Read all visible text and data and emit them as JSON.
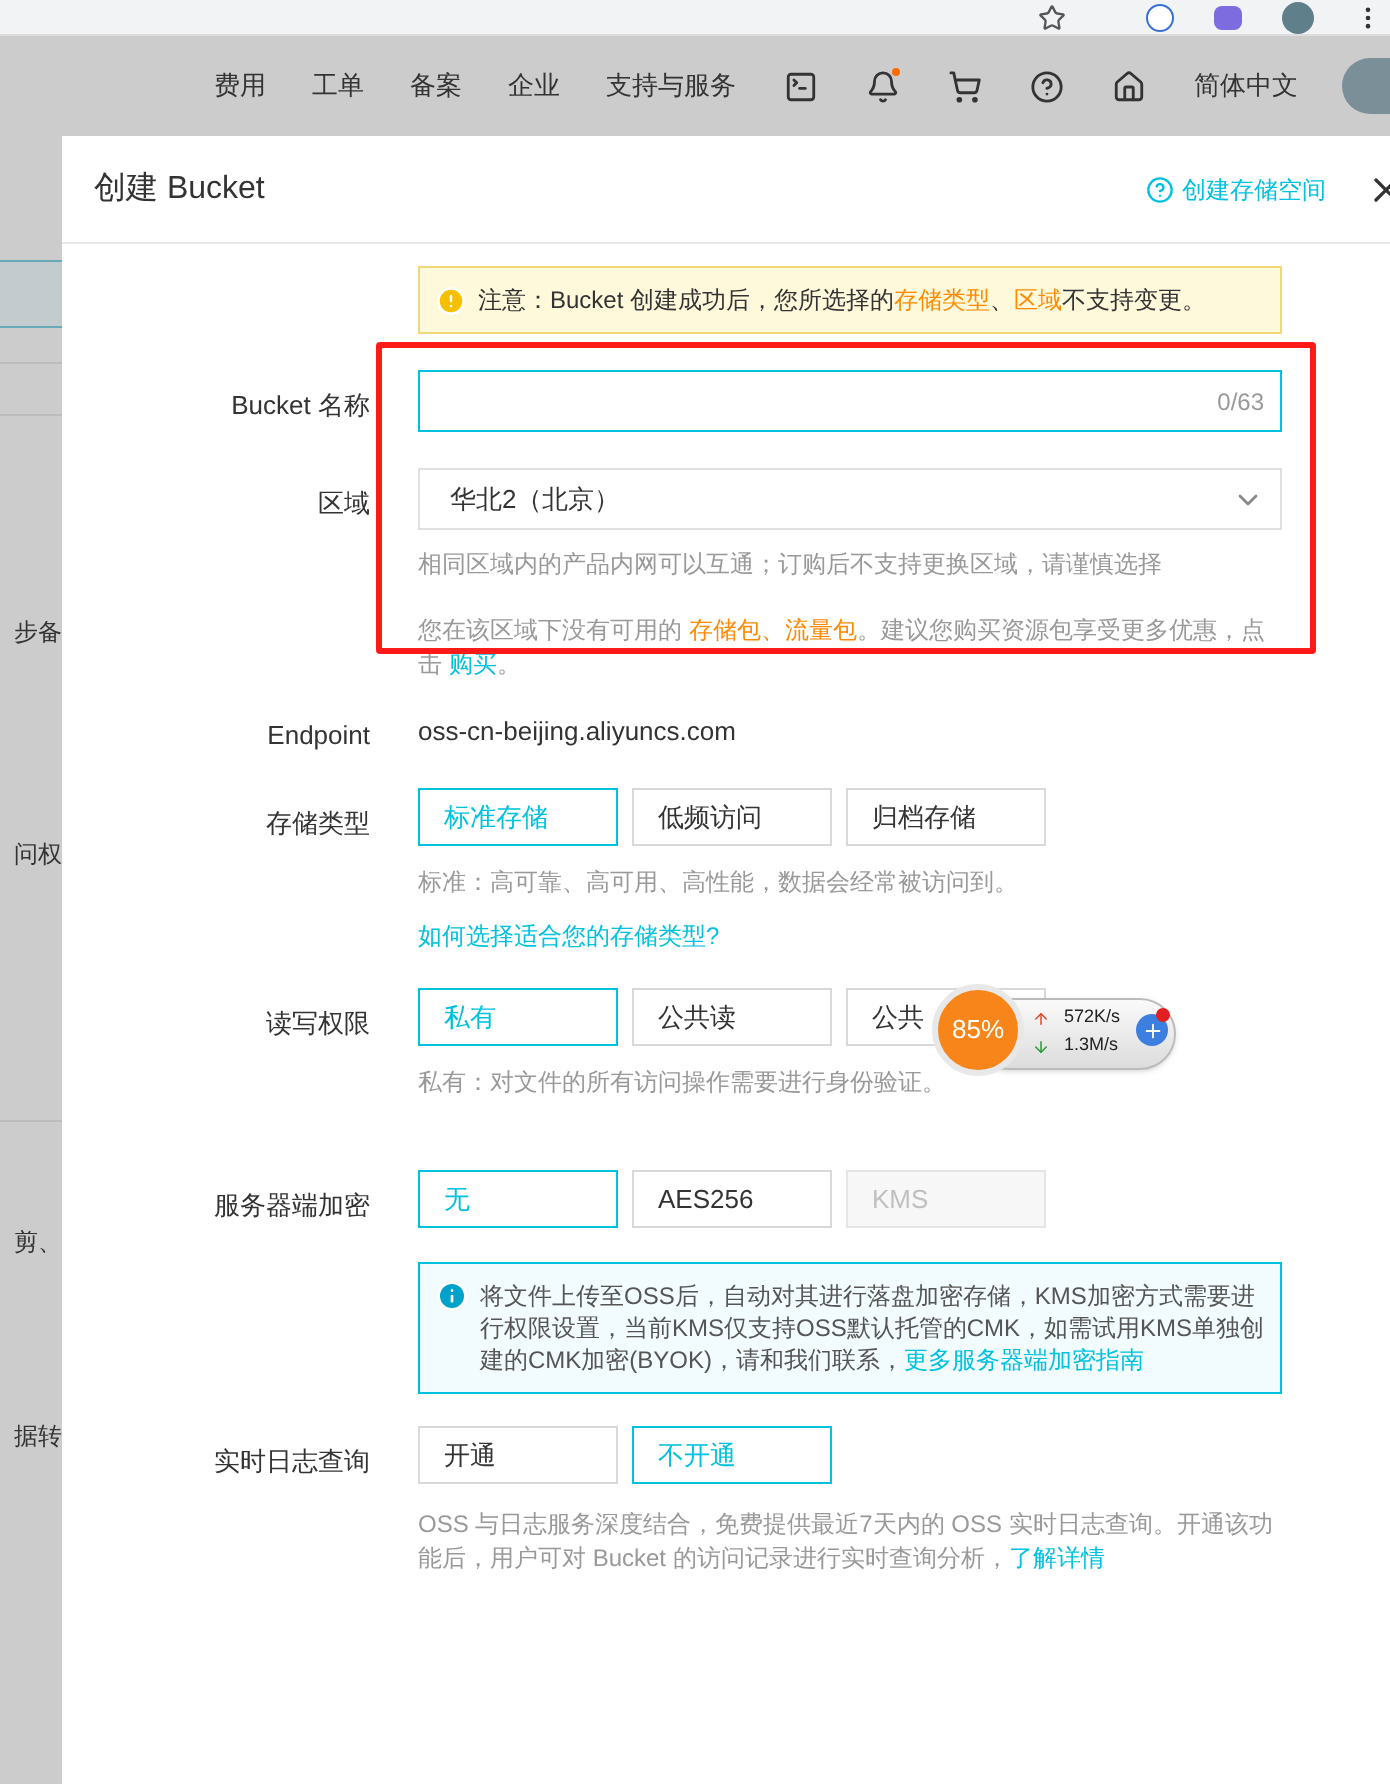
{
  "header": {
    "nav": [
      "费用",
      "工单",
      "备案",
      "企业",
      "支持与服务"
    ],
    "notification_unread": true,
    "language": "简体中文"
  },
  "sidebar": {
    "fragments": [
      "步备",
      "问权",
      "剪、",
      "据转"
    ]
  },
  "panel": {
    "title": "创建 Bucket",
    "help_link": "创建存储空间",
    "notice": "注意：Bucket 创建成功后，您所选择的**存储类型**、**区域**不支持变更。",
    "bucket_name": {
      "label": "Bucket 名称",
      "counter": "0/63"
    },
    "region": {
      "label": "区域",
      "value": "华北2（北京）",
      "hint": "相同区域内的产品内网可以互通；订购后不支持更换区域，请谨慎选择",
      "purchase": {
        "before": "您在该区域下没有可用的 **存储包、流量包**。建议您购买资源包享受更多优惠，点击 ",
        "link": "购买",
        "after": "。"
      }
    },
    "endpoint": {
      "label": "Endpoint",
      "value": "oss-cn-beijing.aliyuncs.com"
    },
    "storage_class": {
      "label": "存储类型",
      "options": [
        {
          "label": "标准存储",
          "selected": true,
          "disabled": false
        },
        {
          "label": "低频访问",
          "selected": false,
          "disabled": false
        },
        {
          "label": "归档存储",
          "selected": false,
          "disabled": false
        }
      ],
      "hint": "标准：高可靠、高可用、高性能，数据会经常被访问到。",
      "link": "如何选择适合您的存储类型?"
    },
    "acl": {
      "label": "读写权限",
      "options": [
        {
          "label": "私有",
          "selected": true,
          "disabled": false
        },
        {
          "label": "公共读",
          "selected": false,
          "disabled": false
        },
        {
          "label": "公共",
          "selected": false,
          "disabled": false
        }
      ],
      "hint": "私有：对文件的所有访问操作需要进行身份验证。"
    },
    "encryption": {
      "label": "服务器端加密",
      "options": [
        {
          "label": "无",
          "selected": true,
          "disabled": false
        },
        {
          "label": "AES256",
          "selected": false,
          "disabled": false
        },
        {
          "label": "KMS",
          "selected": false,
          "disabled": true
        }
      ],
      "info": {
        "text": "将文件上传至OSS后，自动对其进行落盘加密存储，KMS加密方式需要进行权限设置，当前KMS仅支持OSS默认托管的CMK，如需试用KMS单独创建的CMK加密(BYOK)，请和我们联系，",
        "link": "更多服务器端加密指南"
      }
    },
    "realtime_log": {
      "label": "实时日志查询",
      "options": [
        {
          "label": "开通",
          "selected": false,
          "disabled": false
        },
        {
          "label": "不开通",
          "selected": true,
          "disabled": false
        }
      ],
      "hint": {
        "text": "OSS 与日志服务深度结合，免费提供最近7天内的 OSS 实时日志查询。开通该功能后，用户可对 Bucket 的访问记录进行实时查询分析，",
        "link": "了解详情"
      }
    }
  },
  "network_widget": {
    "percent": "85%",
    "upload": "572K/s",
    "download": "1.3M/s"
  }
}
